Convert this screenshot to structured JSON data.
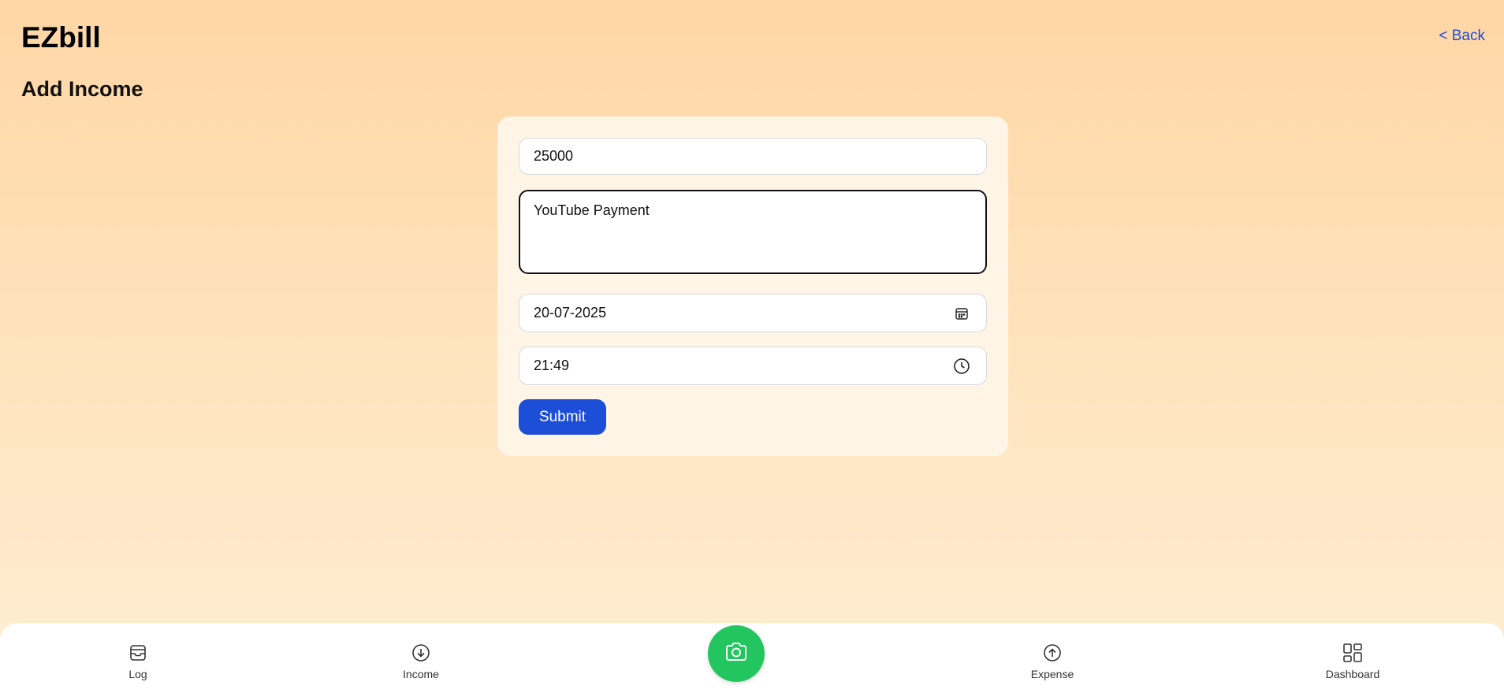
{
  "header": {
    "app_title": "EZbill",
    "back_label": "< Back"
  },
  "page": {
    "title": "Add Income"
  },
  "form": {
    "amount_value": "25000",
    "description_value": "YouTube Payment",
    "date_value": "20-07-2025",
    "time_value": "21:49",
    "submit_label": "Submit"
  },
  "nav": {
    "items": [
      {
        "label": "Log",
        "icon": "inbox-icon"
      },
      {
        "label": "Income",
        "icon": "arrow-down-circle-icon"
      },
      {
        "label": "",
        "icon": "camera-icon"
      },
      {
        "label": "Expense",
        "icon": "arrow-up-circle-icon"
      },
      {
        "label": "Dashboard",
        "icon": "grid-icon"
      }
    ]
  },
  "colors": {
    "accent": "#1d4ed8",
    "camera": "#22c55e",
    "card": "#fff5e7"
  }
}
